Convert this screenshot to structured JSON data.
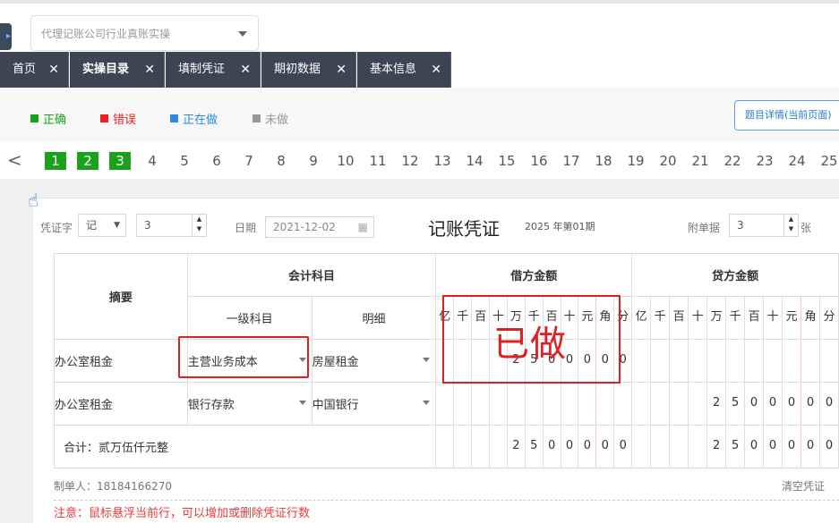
{
  "topbar": {
    "select_text": "代理记账公司行业真账实操"
  },
  "tabs": [
    "首页",
    "实操目录",
    "填制凭证",
    "期初数据",
    "基本信息"
  ],
  "legend": [
    {
      "label": "正确",
      "color": "#1aa31a"
    },
    {
      "label": "错误",
      "color": "#e82020"
    },
    {
      "label": "正在做",
      "color": "#2a8be0"
    },
    {
      "label": "未做",
      "color": "#999999"
    }
  ],
  "detail_button": "题目详情(当前页面)",
  "pager": {
    "pages": [
      "1",
      "2",
      "3",
      "4",
      "5",
      "6",
      "7",
      "8",
      "9",
      "10",
      "11",
      "12",
      "13",
      "14",
      "15",
      "16",
      "17",
      "18",
      "19",
      "20",
      "21",
      "22",
      "23",
      "24",
      "25"
    ],
    "done": [
      "1",
      "2",
      "3"
    ]
  },
  "voucher": {
    "word_label": "凭证字",
    "word_value": "记",
    "number_value": "3",
    "date_label": "日期",
    "date_value": "2021-12-02",
    "title": "记账凭证",
    "period": "2025 年第01期",
    "attach_label": "附单据",
    "attach_value": "3",
    "attach_unit": "张"
  },
  "table": {
    "col_summary": "摘要",
    "col_subject": "会计科目",
    "col_debit": "借方金额",
    "col_credit": "贷方金额",
    "col_level1": "一级科目",
    "col_detail": "明细",
    "digit_labels": [
      "亿",
      "千",
      "百",
      "十",
      "万",
      "千",
      "百",
      "十",
      "元",
      "角",
      "分"
    ],
    "rows": [
      {
        "summary": "办公室租金",
        "level1": "主营业务成本",
        "detail": "房屋租金",
        "debit": [
          "",
          "",
          "",
          "",
          "2",
          "5",
          "0",
          "0",
          "0",
          "0",
          "0"
        ],
        "credit": [
          "",
          "",
          "",
          "",
          "",
          "",
          "",
          "",
          "",
          "",
          ""
        ]
      },
      {
        "summary": "办公室租金",
        "level1": "银行存款",
        "detail": "中国银行",
        "debit": [
          "",
          "",
          "",
          "",
          "",
          "",
          "",
          "",
          "",
          "",
          ""
        ],
        "credit": [
          "",
          "",
          "",
          "",
          "2",
          "5",
          "0",
          "0",
          "0",
          "0",
          "0"
        ]
      }
    ],
    "total_label": "合计：贰万伍仟元整",
    "total_debit": [
      "",
      "",
      "",
      "",
      "2",
      "5",
      "0",
      "0",
      "0",
      "0",
      "0"
    ],
    "total_credit": [
      "",
      "",
      "",
      "",
      "2",
      "5",
      "0",
      "0",
      "0",
      "0",
      "0"
    ]
  },
  "maker": "制单人：18184166270",
  "clear": "清空凭证",
  "note": "注意：鼠标悬浮当前行，可以增加或删除凭证行数",
  "stamp": "已做"
}
